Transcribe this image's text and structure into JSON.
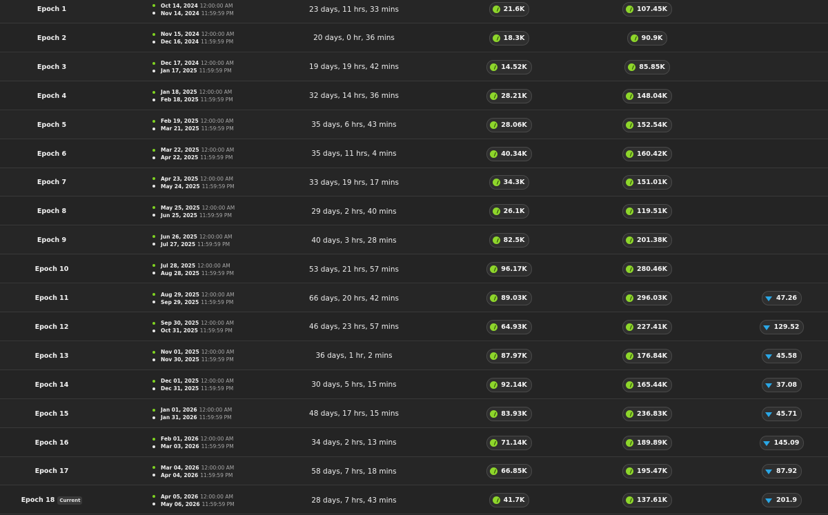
{
  "colors": {
    "background": "#232323",
    "start_dot": "#7fd321",
    "coin": "#8ed62b",
    "gem": "#2aa7e6"
  },
  "rows": [
    {
      "epoch": "Epoch 1",
      "start_date": "Oct 14, 2024",
      "start_time": "12:00:00 AM",
      "end_date": "Nov 14, 2024",
      "end_time": "11:59:59 PM",
      "duration": "23 days, 11 hrs, 33 mins",
      "value1": "21.6K",
      "value2": "107.45K",
      "value3": ""
    },
    {
      "epoch": "Epoch 2",
      "start_date": "Nov 15, 2024",
      "start_time": "12:00:00 AM",
      "end_date": "Dec 16, 2024",
      "end_time": "11:59:59 PM",
      "duration": "20 days, 0 hr, 36 mins",
      "value1": "18.3K",
      "value2": "90.9K",
      "value3": ""
    },
    {
      "epoch": "Epoch 3",
      "start_date": "Dec 17, 2024",
      "start_time": "12:00:00 AM",
      "end_date": "Jan 17, 2025",
      "end_time": "11:59:59 PM",
      "duration": "19 days, 19 hrs, 42 mins",
      "value1": "14.52K",
      "value2": "85.85K",
      "value3": ""
    },
    {
      "epoch": "Epoch 4",
      "start_date": "Jan 18, 2025",
      "start_time": "12:00:00 AM",
      "end_date": "Feb 18, 2025",
      "end_time": "11:59:59 PM",
      "duration": "32 days, 14 hrs, 36 mins",
      "value1": "28.21K",
      "value2": "148.04K",
      "value3": ""
    },
    {
      "epoch": "Epoch 5",
      "start_date": "Feb 19, 2025",
      "start_time": "12:00:00 AM",
      "end_date": "Mar 21, 2025",
      "end_time": "11:59:59 PM",
      "duration": "35 days, 6 hrs, 43 mins",
      "value1": "28.06K",
      "value2": "152.54K",
      "value3": ""
    },
    {
      "epoch": "Epoch 6",
      "start_date": "Mar 22, 2025",
      "start_time": "12:00:00 AM",
      "end_date": "Apr 22, 2025",
      "end_time": "11:59:59 PM",
      "duration": "35 days, 11 hrs, 4 mins",
      "value1": "40.34K",
      "value2": "160.42K",
      "value3": ""
    },
    {
      "epoch": "Epoch 7",
      "start_date": "Apr 23, 2025",
      "start_time": "12:00:00 AM",
      "end_date": "May 24, 2025",
      "end_time": "11:59:59 PM",
      "duration": "33 days, 19 hrs, 17 mins",
      "value1": "34.3K",
      "value2": "151.01K",
      "value3": ""
    },
    {
      "epoch": "Epoch 8",
      "start_date": "May 25, 2025",
      "start_time": "12:00:00 AM",
      "end_date": "Jun 25, 2025",
      "end_time": "11:59:59 PM",
      "duration": "29 days, 2 hrs, 40 mins",
      "value1": "26.1K",
      "value2": "119.51K",
      "value3": ""
    },
    {
      "epoch": "Epoch 9",
      "start_date": "Jun 26, 2025",
      "start_time": "12:00:00 AM",
      "end_date": "Jul 27, 2025",
      "end_time": "11:59:59 PM",
      "duration": "40 days, 3 hrs, 28 mins",
      "value1": "82.5K",
      "value2": "201.38K",
      "value3": ""
    },
    {
      "epoch": "Epoch 10",
      "start_date": "Jul 28, 2025",
      "start_time": "12:00:00 AM",
      "end_date": "Aug 28, 2025",
      "end_time": "11:59:59 PM",
      "duration": "53 days, 21 hrs, 57 mins",
      "value1": "96.17K",
      "value2": "280.46K",
      "value3": ""
    },
    {
      "epoch": "Epoch 11",
      "start_date": "Aug 29, 2025",
      "start_time": "12:00:00 AM",
      "end_date": "Sep 29, 2025",
      "end_time": "11:59:59 PM",
      "duration": "66 days, 20 hrs, 42 mins",
      "value1": "89.03K",
      "value2": "296.03K",
      "value3": "47.26"
    },
    {
      "epoch": "Epoch 12",
      "start_date": "Sep 30, 2025",
      "start_time": "12:00:00 AM",
      "end_date": "Oct 31, 2025",
      "end_time": "11:59:59 PM",
      "duration": "46 days, 23 hrs, 57 mins",
      "value1": "64.93K",
      "value2": "227.41K",
      "value3": "129.52"
    },
    {
      "epoch": "Epoch 13",
      "start_date": "Nov 01, 2025",
      "start_time": "12:00:00 AM",
      "end_date": "Nov 30, 2025",
      "end_time": "11:59:59 PM",
      "duration": "36 days, 1 hr, 2 mins",
      "value1": "87.97K",
      "value2": "176.84K",
      "value3": "45.58"
    },
    {
      "epoch": "Epoch 14",
      "start_date": "Dec 01, 2025",
      "start_time": "12:00:00 AM",
      "end_date": "Dec 31, 2025",
      "end_time": "11:59:59 PM",
      "duration": "30 days, 5 hrs, 15 mins",
      "value1": "92.14K",
      "value2": "165.44K",
      "value3": "37.08"
    },
    {
      "epoch": "Epoch 15",
      "start_date": "Jan 01, 2026",
      "start_time": "12:00:00 AM",
      "end_date": "Jan 31, 2026",
      "end_time": "11:59:59 PM",
      "duration": "48 days, 17 hrs, 15 mins",
      "value1": "83.93K",
      "value2": "236.83K",
      "value3": "45.71"
    },
    {
      "epoch": "Epoch 16",
      "start_date": "Feb 01, 2026",
      "start_time": "12:00:00 AM",
      "end_date": "Mar 03, 2026",
      "end_time": "11:59:59 PM",
      "duration": "34 days, 2 hrs, 13 mins",
      "value1": "71.14K",
      "value2": "189.89K",
      "value3": "145.09"
    },
    {
      "epoch": "Epoch 17",
      "start_date": "Mar 04, 2026",
      "start_time": "12:00:00 AM",
      "end_date": "Apr 04, 2026",
      "end_time": "11:59:59 PM",
      "duration": "58 days, 7 hrs, 18 mins",
      "value1": "66.85K",
      "value2": "195.47K",
      "value3": "87.92"
    },
    {
      "epoch": "Epoch 18",
      "badge": "Current",
      "start_date": "Apr 05, 2026",
      "start_time": "12:00:00 AM",
      "end_date": "May 06, 2026",
      "end_time": "11:59:59 PM",
      "duration": "28 days, 7 hrs, 43 mins",
      "value1": "41.7K",
      "value2": "137.61K",
      "value3": "201.9"
    }
  ]
}
